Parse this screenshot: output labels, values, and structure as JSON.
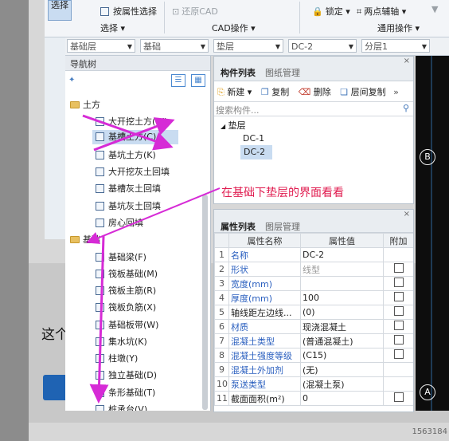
{
  "ribbon": {
    "select_label": "选择",
    "attr_select": "按属性选择",
    "restore_cad": "还原CAD",
    "lock": "锁定",
    "two_point": "两点辅轴",
    "group_select": "选择",
    "group_cad": "CAD操作",
    "group_common": "通用操作"
  },
  "selectors": [
    "基础层",
    "基础",
    "垫层",
    "DC-2",
    "分层1"
  ],
  "nav": {
    "title": "导航树",
    "cat_earth": "土方",
    "earth_items": [
      "大开挖土方(W)",
      "基槽土方(C)",
      "基坑土方(K)",
      "大开挖灰土回填",
      "基槽灰土回填",
      "基坑灰土回填",
      "房心回填"
    ],
    "cat_foundation": "基础",
    "foundation_items": [
      "基础梁(F)",
      "筏板基础(M)",
      "筏板主筋(R)",
      "筏板负筋(X)",
      "基础板带(W)",
      "集水坑(K)",
      "柱墩(Y)",
      "独立基础(D)",
      "条形基础(T)",
      "桩承台(V)"
    ]
  },
  "comp": {
    "tab_list": "构件列表",
    "tab_drawing": "图纸管理",
    "btn_new": "新建",
    "btn_copy": "复制",
    "btn_delete": "删除",
    "btn_layer_copy": "层间复制",
    "search_placeholder": "搜索构件...",
    "tree_parent": "垫层",
    "tree_children": [
      "DC-1",
      "DC-2"
    ]
  },
  "prop": {
    "tab_attr": "属性列表",
    "tab_layer": "图层管理",
    "col_name": "属性名称",
    "col_value": "属性值",
    "col_extra": "附加",
    "rows": [
      {
        "n": "1",
        "name": "名称",
        "value": "DC-2",
        "cb": false
      },
      {
        "n": "2",
        "name": "形状",
        "value": "线型",
        "cb": true
      },
      {
        "n": "3",
        "name": "宽度(mm)",
        "value": "",
        "cb": true
      },
      {
        "n": "4",
        "name": "厚度(mm)",
        "value": "100",
        "cb": true
      },
      {
        "n": "5",
        "name": "轴线距左边线...",
        "value": "(0)",
        "cb": true
      },
      {
        "n": "6",
        "name": "材质",
        "value": "现浇混凝土",
        "cb": true
      },
      {
        "n": "7",
        "name": "混凝土类型",
        "value": "(普通混凝土)",
        "cb": true
      },
      {
        "n": "8",
        "name": "混凝土强度等级",
        "value": "(C15)",
        "cb": true
      },
      {
        "n": "9",
        "name": "混凝土外加剂",
        "value": "(无)",
        "cb": false
      },
      {
        "n": "10",
        "name": "泵送类型",
        "value": "(混凝土泵)",
        "cb": false
      },
      {
        "n": "11",
        "name": "截面面积(m²)",
        "value": "0",
        "cb": true
      }
    ]
  },
  "canvas": {
    "axis_b": "B",
    "axis_a": "A"
  },
  "annotation": "在基础下垫层的界面看看",
  "background_text": "这个",
  "watermark": "1563184"
}
